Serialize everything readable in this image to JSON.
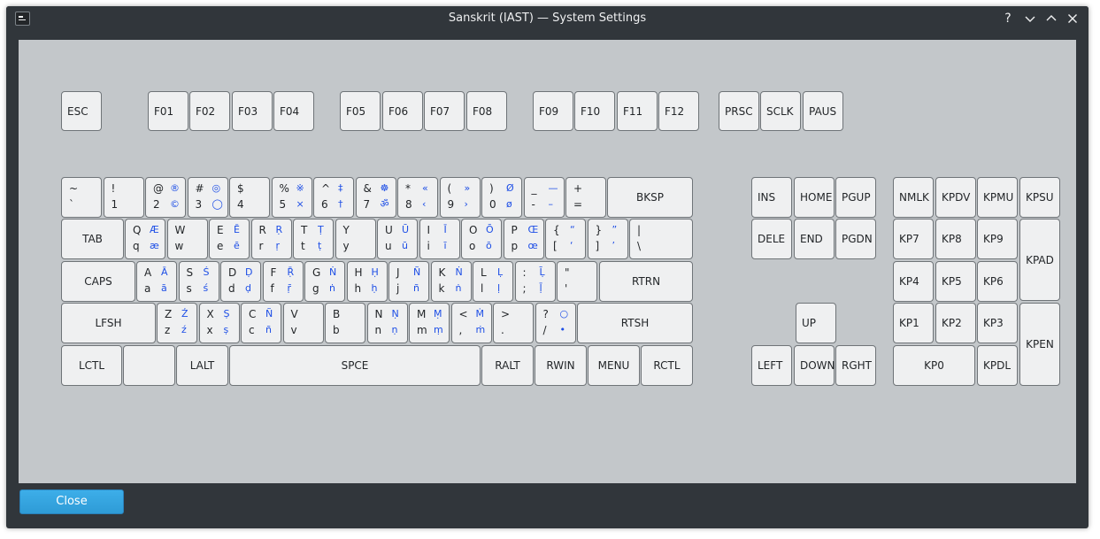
{
  "window": {
    "title": "Sanskrit (IAST) — System Settings",
    "help_label": "?",
    "close_button_label": "Close"
  },
  "colors": {
    "titlebar": "#31363b",
    "keyboard_background": "#c3c7ca",
    "key_face": "#eff0f1",
    "altgr_symbol": "#1d4ee6",
    "accent_button": "#3daee9"
  },
  "keys": {
    "esc": "ESC",
    "f01": "F01",
    "f02": "F02",
    "f03": "F03",
    "f04": "F04",
    "f05": "F05",
    "f06": "F06",
    "f07": "F07",
    "f08": "F08",
    "f09": "F09",
    "f10": "F10",
    "f11": "F11",
    "f12": "F12",
    "prsc": "PRSC",
    "sclk": "SCLK",
    "paus": "PAUS",
    "bksp": "BKSP",
    "tab": "TAB",
    "caps": "CAPS",
    "rtrn": "RTRN",
    "lfsh": "LFSH",
    "rtsh": "RTSH",
    "lctl": "LCTL",
    "lwin": "",
    "lalt": "LALT",
    "spce": "SPCE",
    "ralt": "RALT",
    "rwin": "RWIN",
    "menu": "MENU",
    "rctl": "RCTL",
    "ins": "INS",
    "home": "HOME",
    "pgup": "PGUP",
    "dele": "DELE",
    "end": "END",
    "pgdn": "PGDN",
    "up": "UP",
    "left": "LEFT",
    "down": "DOWN",
    "rght": "RGHT",
    "nmlk": "NMLK",
    "kpdv": "KPDV",
    "kpmu": "KPMU",
    "kpsu": "KPSU",
    "kp7": "KP7",
    "kp8": "KP8",
    "kp9": "KP9",
    "kpad": "KPAD",
    "kp4": "KP4",
    "kp5": "KP5",
    "kp6": "KP6",
    "kp1": "KP1",
    "kp2": "KP2",
    "kp3": "KP3",
    "kpen": "KPEN",
    "kp0": "KP0",
    "kpdl": "KPDL"
  },
  "char_keys": {
    "tlde": {
      "s": "~",
      "n": "`",
      "as": "",
      "an": ""
    },
    "ae01": {
      "s": "!",
      "n": "1",
      "as": "",
      "an": ""
    },
    "ae02": {
      "s": "@",
      "n": "2",
      "as": "®",
      "an": "©"
    },
    "ae03": {
      "s": "#",
      "n": "3",
      "as": "◎",
      "an": "◯"
    },
    "ae04": {
      "s": "$",
      "n": "4",
      "as": "",
      "an": ""
    },
    "ae05": {
      "s": "%",
      "n": "5",
      "as": "※",
      "an": "×"
    },
    "ae06": {
      "s": "^",
      "n": "6",
      "as": "‡",
      "an": "†"
    },
    "ae07": {
      "s": "&",
      "n": "7",
      "as": "☸",
      "an": "ॐ"
    },
    "ae08": {
      "s": "*",
      "n": "8",
      "as": "«",
      "an": "‹"
    },
    "ae09": {
      "s": "(",
      "n": "9",
      "as": "»",
      "an": "›"
    },
    "ae10": {
      "s": ")",
      "n": "0",
      "as": "Ø",
      "an": "ø"
    },
    "ae11": {
      "s": "_",
      "n": "-",
      "as": "—",
      "an": "–"
    },
    "ae12": {
      "s": "+",
      "n": "=",
      "as": "",
      "an": ""
    },
    "ad01": {
      "s": "Q",
      "n": "q",
      "as": "Æ",
      "an": "æ"
    },
    "ad02": {
      "s": "W",
      "n": "w",
      "as": "",
      "an": ""
    },
    "ad03": {
      "s": "E",
      "n": "e",
      "as": "Ē",
      "an": "ē"
    },
    "ad04": {
      "s": "R",
      "n": "r",
      "as": "Ṛ",
      "an": "ṛ"
    },
    "ad05": {
      "s": "T",
      "n": "t",
      "as": "Ṭ",
      "an": "ṭ"
    },
    "ad06": {
      "s": "Y",
      "n": "y",
      "as": "",
      "an": ""
    },
    "ad07": {
      "s": "U",
      "n": "u",
      "as": "Ū",
      "an": "ū"
    },
    "ad08": {
      "s": "I",
      "n": "i",
      "as": "Ī",
      "an": "ī"
    },
    "ad09": {
      "s": "O",
      "n": "o",
      "as": "Ō",
      "an": "ō"
    },
    "ad10": {
      "s": "P",
      "n": "p",
      "as": "Œ",
      "an": "œ"
    },
    "ad11": {
      "s": "{",
      "n": "[",
      "as": "“",
      "an": "‘"
    },
    "ad12": {
      "s": "}",
      "n": "]",
      "as": "”",
      "an": "’"
    },
    "bksl": {
      "s": "|",
      "n": "\\",
      "as": "",
      "an": ""
    },
    "ac01": {
      "s": "A",
      "n": "a",
      "as": "Ā",
      "an": "ā"
    },
    "ac02": {
      "s": "S",
      "n": "s",
      "as": "Ś",
      "an": "ś"
    },
    "ac03": {
      "s": "D",
      "n": "d",
      "as": "Ḍ",
      "an": "ḍ"
    },
    "ac04": {
      "s": "F",
      "n": "f",
      "as": "Ṝ",
      "an": "ṝ"
    },
    "ac05": {
      "s": "G",
      "n": "g",
      "as": "Ṅ",
      "an": "ṅ"
    },
    "ac06": {
      "s": "H",
      "n": "h",
      "as": "Ḥ",
      "an": "ḥ"
    },
    "ac07": {
      "s": "J",
      "n": "j",
      "as": "Ñ",
      "an": "ñ"
    },
    "ac08": {
      "s": "K",
      "n": "k",
      "as": "Ṅ",
      "an": "ṅ"
    },
    "ac09": {
      "s": "L",
      "n": "l",
      "as": "Ḷ",
      "an": "ḷ"
    },
    "ac10": {
      "s": ":",
      "n": ";",
      "as": "Ḹ",
      "an": "ḹ"
    },
    "ac11": {
      "s": "\"",
      "n": "'",
      "as": "",
      "an": ""
    },
    "ab01": {
      "s": "Z",
      "n": "z",
      "as": "Ź",
      "an": "ź"
    },
    "ab02": {
      "s": "X",
      "n": "x",
      "as": "Ṣ",
      "an": "ṣ"
    },
    "ab03": {
      "s": "C",
      "n": "c",
      "as": "Ñ",
      "an": "ñ"
    },
    "ab04": {
      "s": "V",
      "n": "v",
      "as": "",
      "an": ""
    },
    "ab05": {
      "s": "B",
      "n": "b",
      "as": "",
      "an": ""
    },
    "ab06": {
      "s": "N",
      "n": "n",
      "as": "Ṇ",
      "an": "ṇ"
    },
    "ab07": {
      "s": "M",
      "n": "m",
      "as": "Ṃ",
      "an": "ṃ"
    },
    "ab08": {
      "s": "<",
      "n": ",",
      "as": "Ṁ",
      "an": "ṁ"
    },
    "ab09": {
      "s": ">",
      "n": ".",
      "as": "",
      "an": ""
    },
    "ab10": {
      "s": "?",
      "n": "/",
      "as": "○",
      "an": "•"
    }
  }
}
